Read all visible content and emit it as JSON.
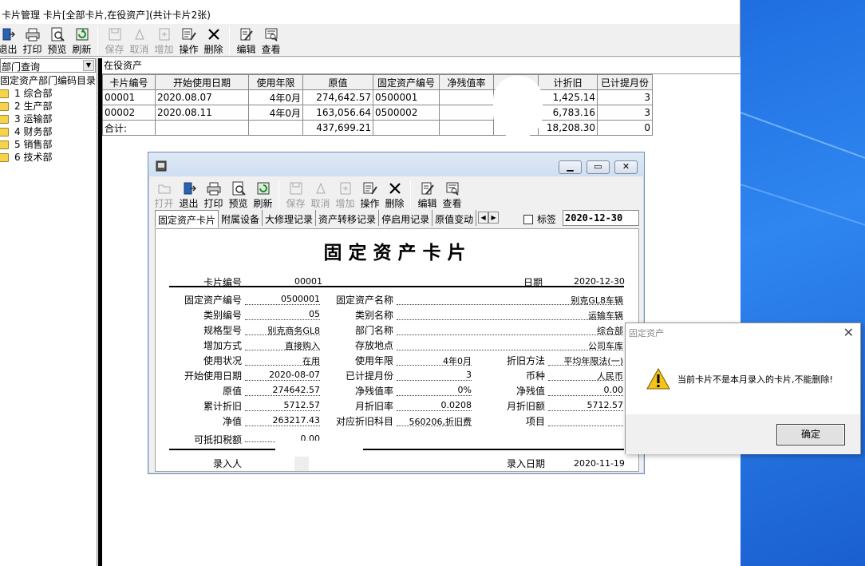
{
  "main_window": {
    "title": "卡片管理 卡片[全部卡片,在役资产](共计卡片2张)",
    "toolbar": [
      {
        "label": "退出",
        "icon": "exit-icon",
        "enabled": true
      },
      {
        "label": "打印",
        "icon": "print-icon",
        "enabled": true
      },
      {
        "label": "预览",
        "icon": "preview-icon",
        "enabled": true
      },
      {
        "label": "刷新",
        "icon": "refresh-icon",
        "enabled": true
      },
      {
        "label": "保存",
        "icon": "save-icon",
        "enabled": false
      },
      {
        "label": "取消",
        "icon": "cancel-icon",
        "enabled": false
      },
      {
        "label": "增加",
        "icon": "add-icon",
        "enabled": false
      },
      {
        "label": "操作",
        "icon": "operate-icon",
        "enabled": true
      },
      {
        "label": "删除",
        "icon": "delete-icon",
        "enabled": true
      },
      {
        "label": "编辑",
        "icon": "edit-icon",
        "enabled": true
      },
      {
        "label": "查看",
        "icon": "view-icon",
        "enabled": true
      }
    ]
  },
  "left_panel": {
    "selector_value": "部门查询",
    "tree_root": "固定资产部门编码目录",
    "departments": [
      "1 综合部",
      "2 生产部",
      "3 运输部",
      "4 财务部",
      "5 销售部",
      "6 技术部"
    ]
  },
  "grid": {
    "caption": "在役资产",
    "columns": [
      "卡片编号",
      "开始使用日期",
      "使用年限",
      "原值",
      "固定资产编号",
      "净残值率",
      "",
      "计折旧",
      "已计提月份"
    ],
    "rows": [
      [
        "00001",
        "2020.08.07",
        "4年0月",
        "274,642.57",
        "0500001",
        "",
        "",
        "1,425.14",
        "3"
      ],
      [
        "00002",
        "2020.08.11",
        "4年0月",
        "163,056.64",
        "0500002",
        "",
        "",
        "6,783.16",
        "3"
      ]
    ],
    "total": {
      "label": "合计:",
      "original_value": "437,699.21",
      "depreciation": "18,208.30",
      "months": "0"
    }
  },
  "child_window": {
    "toolbar": [
      {
        "label": "打开",
        "enabled": false
      },
      {
        "label": "退出",
        "enabled": true
      },
      {
        "label": "打印",
        "enabled": true
      },
      {
        "label": "预览",
        "enabled": true
      },
      {
        "label": "刷新",
        "enabled": true
      },
      {
        "label": "保存",
        "enabled": false
      },
      {
        "label": "取消",
        "enabled": false
      },
      {
        "label": "增加",
        "enabled": false
      },
      {
        "label": "操作",
        "enabled": true
      },
      {
        "label": "删除",
        "enabled": true
      },
      {
        "label": "编辑",
        "enabled": true
      },
      {
        "label": "查看",
        "enabled": true
      }
    ],
    "tabs": [
      "固定资产卡片",
      "附属设备",
      "大修理记录",
      "资产转移记录",
      "停启用记录",
      "原值变动"
    ],
    "bookmark_label": "标签",
    "date": "2020-12-30",
    "card": {
      "title": "固定资产卡片",
      "card_no_label": "卡片编号",
      "card_no": "00001",
      "date_label": "日期",
      "date": "2020-12-30",
      "asset_no_label": "固定资产编号",
      "asset_no": "0500001",
      "asset_name_label": "固定资产名称",
      "asset_name": "别克GL8车辆",
      "category_no_label": "类别编号",
      "category_no": "05",
      "category_name_label": "类别名称",
      "category_name": "运输车辆",
      "model_label": "规格型号",
      "model": "别克商务GL8",
      "dept_label": "部门名称",
      "dept": "综合部",
      "add_method_label": "增加方式",
      "add_method": "直接购入",
      "location_label": "存放地点",
      "location": "公司车库",
      "status_label": "使用状况",
      "status": "在用",
      "life_label": "使用年限",
      "life": "4年0月",
      "dep_method_label": "折旧方法",
      "dep_method": "平均年限法(一)",
      "start_date_label": "开始使用日期",
      "start_date": "2020-08-07",
      "months_label": "已计提月份",
      "months": "3",
      "currency_label": "币种",
      "currency": "人民币",
      "orig_label": "原值",
      "orig": "274642.57",
      "salvage_rate_label": "净残值率",
      "salvage_rate": "0%",
      "salvage_label": "净残值",
      "salvage": "0.00",
      "acc_dep_label": "累计折旧",
      "acc_dep": "5712.57",
      "month_rate_label": "月折旧率",
      "month_rate": "0.0208",
      "month_amt_label": "月折旧额",
      "month_amt": "5712.57",
      "net_label": "净值",
      "net": "263217.43",
      "dep_subject_label": "对应折旧科目",
      "dep_subject": "560206,折旧费",
      "item_label": "项目",
      "item": "",
      "tax_label": "可抵扣税额",
      "tax": "0.00",
      "entered_by_label": "录入人",
      "entry_date_label": "录入日期",
      "entry_date": "2020-11-19"
    }
  },
  "dialog": {
    "title": "固定资产",
    "message": "当前卡片不是本月录入的卡片,不能删除!",
    "ok_label": "确定"
  }
}
